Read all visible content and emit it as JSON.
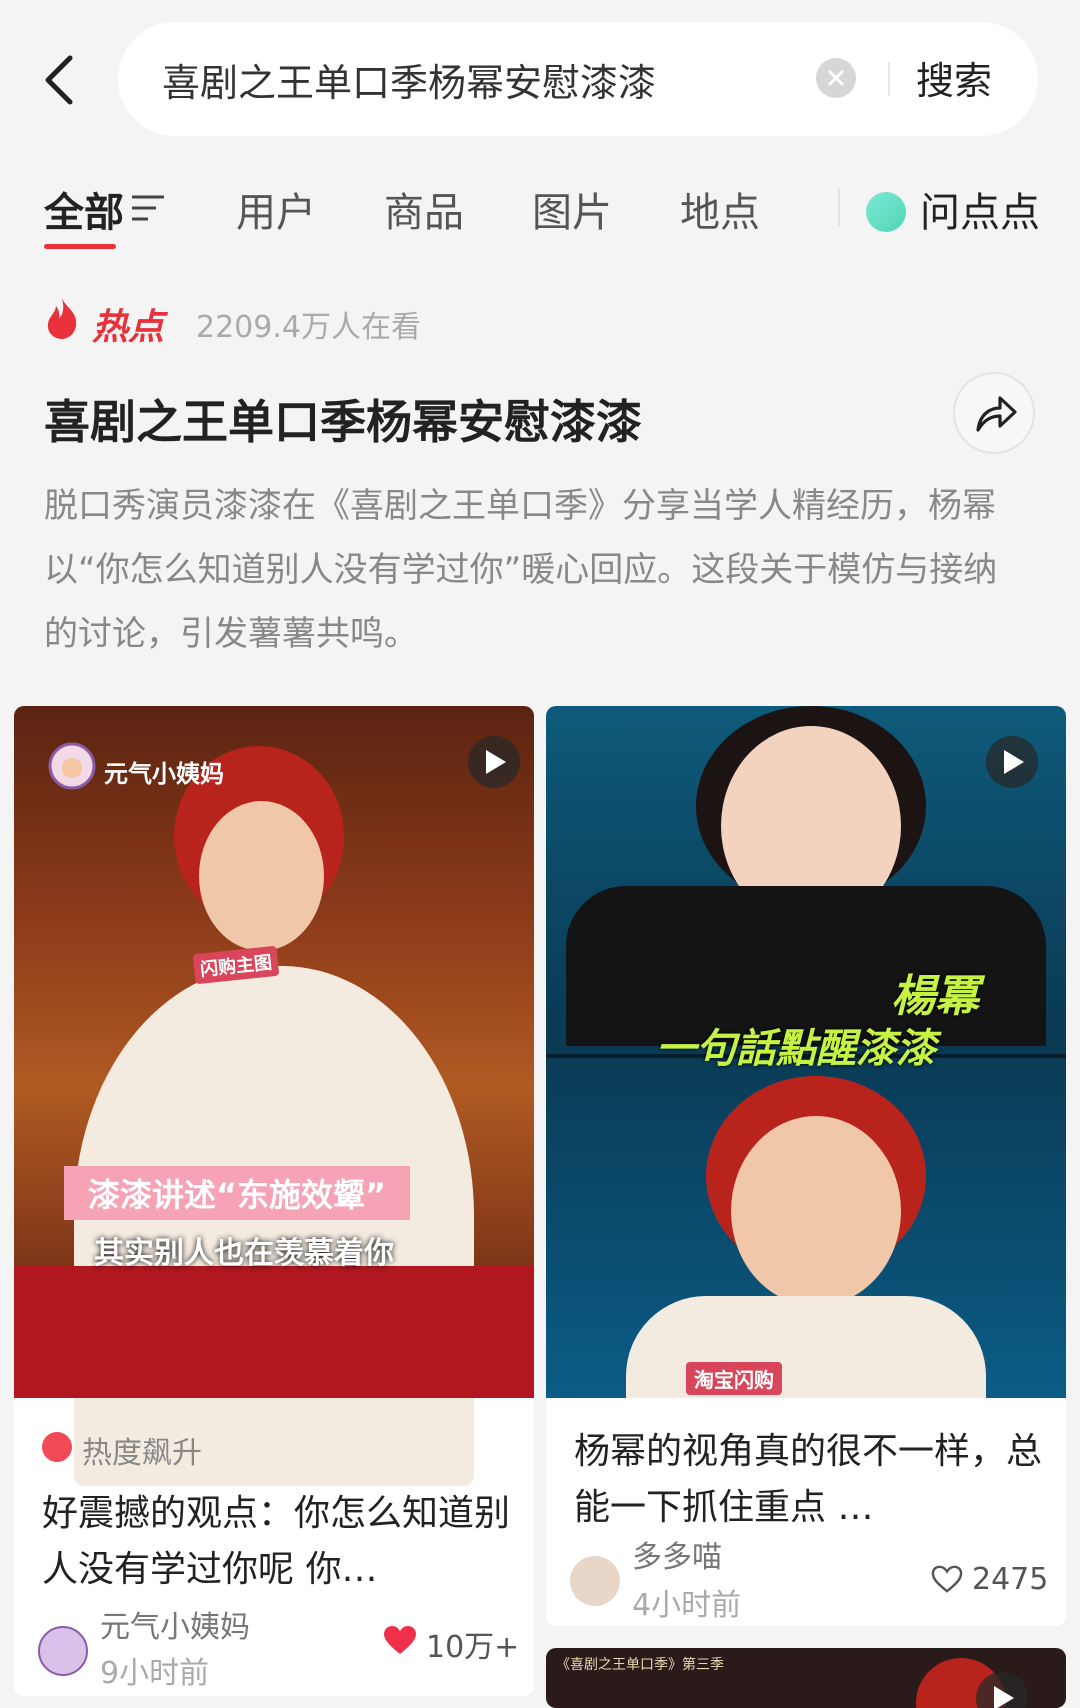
{
  "search": {
    "query": "喜剧之王单口季杨幂安慰漆漆",
    "button_label": "搜索"
  },
  "tabs": [
    {
      "label": "全部"
    },
    {
      "label": "用户"
    },
    {
      "label": "商品"
    },
    {
      "label": "图片"
    },
    {
      "label": "地点"
    },
    {
      "label": "问点点"
    }
  ],
  "hot": {
    "label": "热点",
    "viewers": "2209.4万人在看",
    "title": "喜剧之王单口季杨幂安慰漆漆",
    "description": "脱口秀演员漆漆在《喜剧之王单口季》分享当学人精经历，杨幂以“你怎么知道别人没有学过你”暖心回应。这段关于模仿与接纳的讨论，引发薯薯共鸣。"
  },
  "cards": [
    {
      "watermark": "元气小姨妈",
      "caption_line1": "漆漆讲述“东施效颦”",
      "caption_line2": "其实别人也在羡慕着你",
      "sticker": "闪购主图",
      "badge": "热度飙升",
      "title": "好震撼的观点：你怎么知道别人没有学过你呢 你…",
      "author": "元气小姨妈",
      "time": "9小时前",
      "likes": "10万+"
    },
    {
      "caption_line1": "楊冪",
      "caption_line2": "一句話點醒漆漆",
      "sticker": "淘宝闪购",
      "title": "杨幂的视角真的很不一样，总能一下抓住重点 …",
      "author": "多多喵",
      "time": "4小时前",
      "likes": "2475"
    },
    {
      "caption": "《喜剧之王单口季》第三季"
    }
  ],
  "colors": {
    "accent": "#e8313a",
    "background": "#f4f4f4"
  }
}
